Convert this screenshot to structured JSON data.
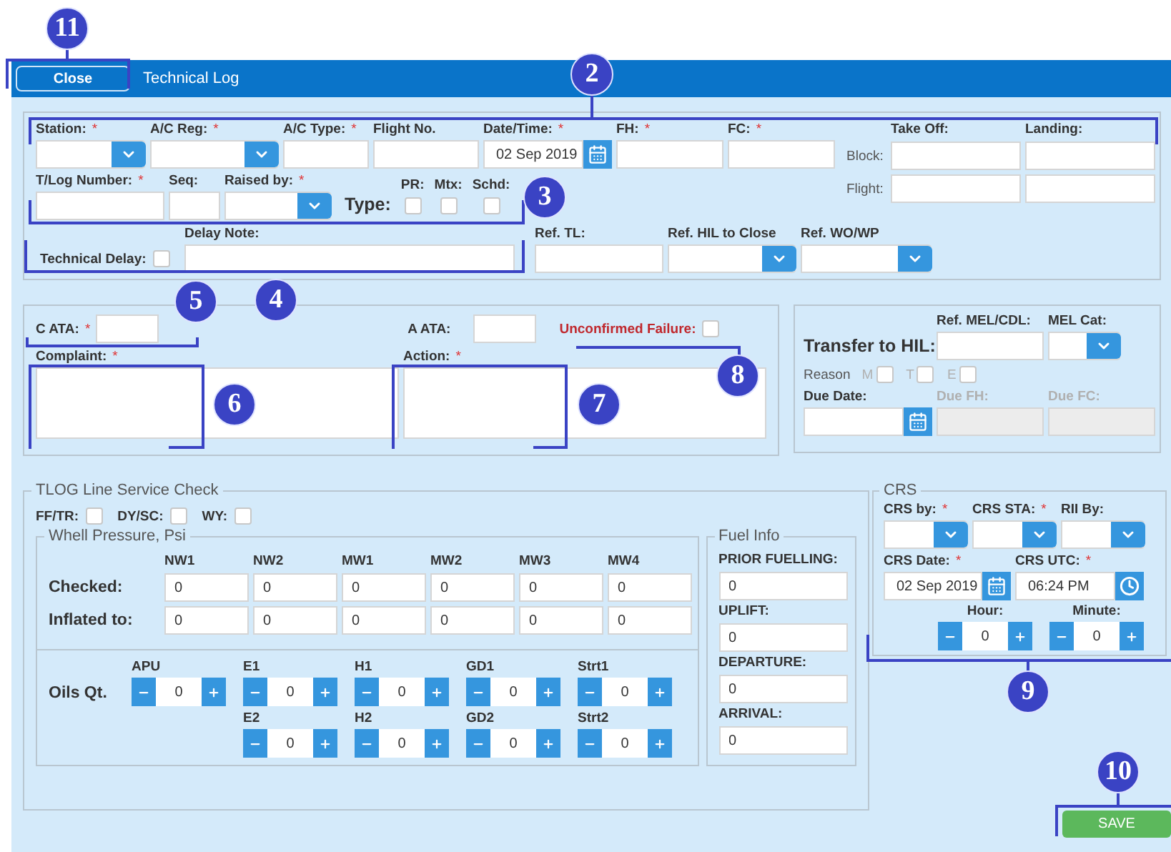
{
  "header": {
    "close_button": "Close",
    "title": "Technical Log"
  },
  "flight": {
    "row1": [
      {
        "kind": "select",
        "label": "Station:",
        "mark": "*"
      },
      {
        "kind": "select",
        "label": "A/C Reg:",
        "mark": "*"
      },
      {
        "kind": "text",
        "label": "A/C Type:",
        "mark": "*"
      },
      {
        "kind": "text",
        "label": "Flight No."
      },
      {
        "kind": "date",
        "label": "Date/Time:",
        "mark": "*",
        "value": "02 Sep 2019"
      },
      {
        "kind": "text",
        "label": "FH:",
        "mark": "*"
      },
      {
        "kind": "text",
        "label": "FC:",
        "mark": "*"
      }
    ],
    "row2": [
      {
        "kind": "text",
        "label": "T/Log Number:",
        "mark": "*"
      },
      {
        "kind": "text",
        "label": "Seq:"
      },
      {
        "kind": "select",
        "label": "Raised by:",
        "mark": "*"
      }
    ],
    "type": {
      "label": "Type:",
      "options": [
        {
          "label": "PR:",
          "checked": false
        },
        {
          "label": "Mtx:",
          "checked": false
        },
        {
          "label": "Schd:",
          "checked": false
        }
      ]
    },
    "times": {
      "columns": [
        "Take Off:",
        "Landing:"
      ],
      "rows": [
        "Block:",
        "Flight:"
      ]
    },
    "delay": {
      "label": "Technical Delay:",
      "checked": false
    },
    "row3": [
      {
        "kind": "text",
        "label": "Delay Note:"
      },
      {
        "kind": "text",
        "label": "Ref. TL:"
      },
      {
        "kind": "select",
        "label": "Ref. HIL to Close"
      },
      {
        "kind": "select",
        "label": "Ref. WO/WP"
      }
    ]
  },
  "fault": {
    "c_ata": {
      "label": "C ATA:",
      "mark": "*"
    },
    "a_ata": {
      "label": "A ATA:"
    },
    "unconfirmed": {
      "label": "Unconfirmed Failure:",
      "checked": false
    },
    "complaint": {
      "label": "Complaint:",
      "mark": "*"
    },
    "action": {
      "label": "Action:",
      "mark": "*"
    }
  },
  "hil": {
    "title": "Transfer to HIL:",
    "fields": [
      {
        "kind": "text",
        "label": "Ref. MEL/CDL:"
      },
      {
        "kind": "select",
        "label": "MEL Cat:"
      }
    ],
    "reason": {
      "label": "Reason",
      "options": [
        {
          "label": "M",
          "checked": false,
          "disabled": true
        },
        {
          "label": "T",
          "checked": false,
          "disabled": true
        },
        {
          "label": "E",
          "checked": false,
          "disabled": true
        }
      ]
    },
    "due": [
      {
        "kind": "date",
        "label": "Due Date:",
        "disabled": false
      },
      {
        "kind": "text",
        "label": "Due FH:",
        "disabled": true
      },
      {
        "kind": "text",
        "label": "Due FC:",
        "disabled": true
      }
    ]
  },
  "line_check": {
    "legend": "TLOG Line Service Check",
    "checks": [
      {
        "label": "FF/TR:",
        "checked": false
      },
      {
        "label": "DY/SC:",
        "checked": false
      },
      {
        "label": "WY:",
        "checked": false
      }
    ],
    "wheel": {
      "legend": "Whell Pressure, Psi",
      "columns": [
        "NW1",
        "NW2",
        "MW1",
        "MW2",
        "MW3",
        "MW4"
      ],
      "rows": [
        {
          "label": "Checked:",
          "values": [
            "0",
            "0",
            "0",
            "0",
            "0",
            "0"
          ]
        },
        {
          "label": "Inflated to:",
          "values": [
            "0",
            "0",
            "0",
            "0",
            "0",
            "0"
          ]
        }
      ]
    },
    "oils": {
      "label": "Oils Qt.",
      "columns": [
        {
          "items": [
            {
              "label": "APU",
              "value": "0"
            }
          ]
        },
        {
          "items": [
            {
              "label": "E1",
              "value": "0"
            },
            {
              "label": "E2",
              "value": "0"
            }
          ]
        },
        {
          "items": [
            {
              "label": "H1",
              "value": "0"
            },
            {
              "label": "H2",
              "value": "0"
            }
          ]
        },
        {
          "items": [
            {
              "label": "GD1",
              "value": "0"
            },
            {
              "label": "GD2",
              "value": "0"
            }
          ]
        },
        {
          "items": [
            {
              "label": "Strt1",
              "value": "0"
            },
            {
              "label": "Strt2",
              "value": "0"
            }
          ]
        }
      ]
    },
    "fuel": {
      "legend": "Fuel Info",
      "fields": [
        {
          "label": "PRIOR FUELLING:",
          "value": "0"
        },
        {
          "label": "UPLIFT:",
          "value": "0"
        },
        {
          "label": "DEPARTURE:",
          "value": "0"
        },
        {
          "label": "ARRIVAL:",
          "value": "0"
        }
      ]
    }
  },
  "crs": {
    "legend": "CRS",
    "row1": [
      {
        "kind": "select",
        "label": "CRS by:",
        "mark": "*"
      },
      {
        "kind": "select",
        "label": "CRS STA:",
        "mark": "*"
      },
      {
        "kind": "select",
        "label": "RII By:"
      }
    ],
    "row2": [
      {
        "kind": "date",
        "label": "CRS Date:",
        "mark": "*",
        "value": "02 Sep 2019"
      },
      {
        "kind": "time",
        "label": "CRS UTC:",
        "mark": "*",
        "value": "06:24 PM"
      }
    ],
    "steppers": [
      {
        "label": "Hour:",
        "value": "0"
      },
      {
        "label": "Minute:",
        "value": "0"
      }
    ]
  },
  "save_button": "SAVE",
  "callouts": [
    {
      "number": "11"
    },
    {
      "number": "2"
    },
    {
      "number": "3"
    },
    {
      "number": "4"
    },
    {
      "number": "5"
    },
    {
      "number": "6"
    },
    {
      "number": "7"
    },
    {
      "number": "8"
    },
    {
      "number": "9"
    },
    {
      "number": "10"
    }
  ]
}
